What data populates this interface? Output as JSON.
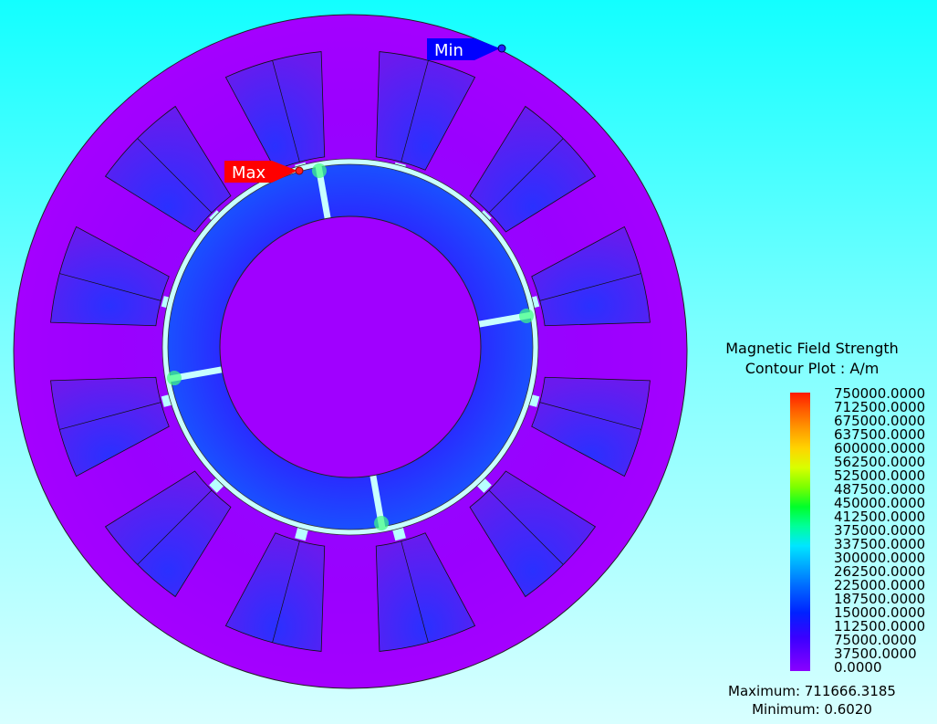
{
  "markers": {
    "max_label": "Max",
    "min_label": "Min",
    "max_color": "#ff0000",
    "min_color": "#0000ff"
  },
  "legend": {
    "title_line1": "Magnetic Field Strength",
    "title_line2": "Contour Plot : A/m",
    "ticks": [
      "750000.0000",
      "712500.0000",
      "675000.0000",
      "637500.0000",
      "600000.0000",
      "562500.0000",
      "525000.0000",
      "487500.0000",
      "450000.0000",
      "412500.0000",
      "375000.0000",
      "337500.0000",
      "300000.0000",
      "262500.0000",
      "225000.0000",
      "187500.0000",
      "150000.0000",
      "112500.0000",
      "75000.0000",
      "37500.0000",
      "0.0000"
    ],
    "maximum_text": "Maximum: 711666.3185",
    "minimum_text": "Minimum: 0.6020"
  },
  "colors": {
    "background_top": "#12ffff",
    "background_bottom": "#d8ffff",
    "stator_core": "#a000ff",
    "slot_fill": "#5020e0",
    "rotor_ring": "#1a3cff",
    "shaft": "#a000ff",
    "air_gap": "#c8ffff"
  }
}
